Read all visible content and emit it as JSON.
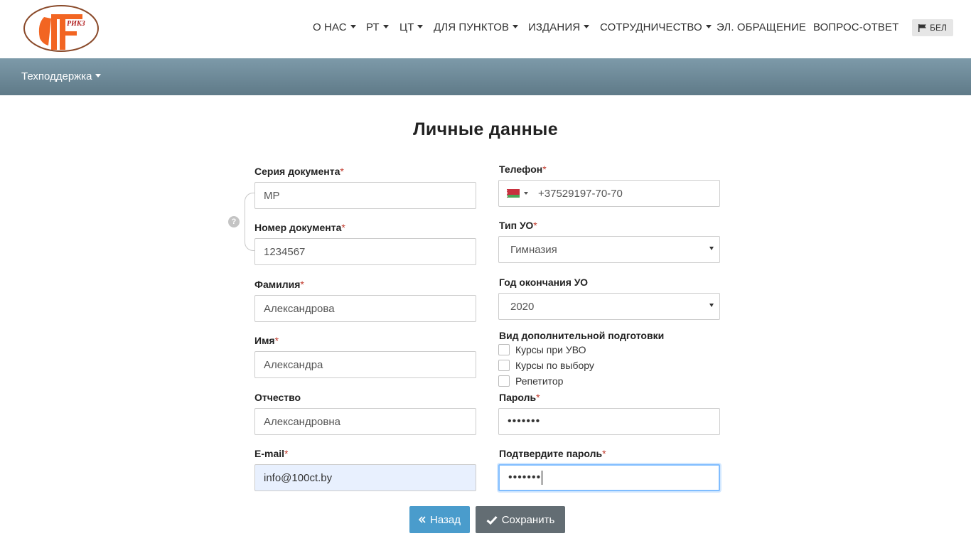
{
  "header": {
    "logo_text": "РИКЗ",
    "nav": [
      {
        "label": "О НАС",
        "dropdown": true
      },
      {
        "label": "РТ",
        "dropdown": true
      },
      {
        "label": "ЦТ",
        "dropdown": true
      },
      {
        "label": "ДЛЯ ПУНКТОВ",
        "dropdown": true
      },
      {
        "label": "ИЗДАНИЯ",
        "dropdown": true
      },
      {
        "label": "СОТРУДНИЧЕСТВО",
        "dropdown": true
      },
      {
        "label": "ЭЛ. ОБРАЩЕНИЕ",
        "dropdown": false
      },
      {
        "label": "ВОПРОС-ОТВЕТ",
        "dropdown": false
      }
    ],
    "lang_button": "БЕЛ",
    "lang_icon": "flag-icon"
  },
  "subbar": {
    "support_label": "Техподдержка"
  },
  "page_title": "Личные данные",
  "form": {
    "required_mark": "*",
    "doc_series": {
      "label": "Серия документа",
      "value": "MP"
    },
    "doc_number": {
      "label": "Номер документа",
      "value": "1234567"
    },
    "help_icon": "?",
    "last_name": {
      "label": "Фамилия",
      "value": "Александрова"
    },
    "first_name": {
      "label": "Имя",
      "value": "Александра"
    },
    "patronymic": {
      "label": "Отчество",
      "value": "Александровна"
    },
    "email": {
      "label": "E-mail",
      "value": "info@100ct.by"
    },
    "phone": {
      "label": "Телефон",
      "value": "+37529197-70-70",
      "country": "BY"
    },
    "school_type": {
      "label": "Тип УО",
      "value": "Гимназия"
    },
    "grad_year": {
      "label": "Год окончания УО",
      "value": "2020"
    },
    "extra_prep": {
      "label": "Вид дополнительной подготовки",
      "options": [
        {
          "label": "Курсы при УВО",
          "checked": false
        },
        {
          "label": "Курсы по выбору",
          "checked": false
        },
        {
          "label": "Репетитор",
          "checked": false
        }
      ]
    },
    "password": {
      "label": "Пароль",
      "value": "•••••••"
    },
    "password_confirm": {
      "label": "Подтвердите пароль",
      "value": "•••••••"
    }
  },
  "buttons": {
    "back": "Назад",
    "save": "Сохранить"
  },
  "colors": {
    "subbar_top": "#7d9aa9",
    "subbar_bottom": "#5f7a88",
    "back_button": "#4a9ccc",
    "save_button": "#636d73",
    "required": "#c0392b",
    "logo_orange": "#f26522"
  }
}
